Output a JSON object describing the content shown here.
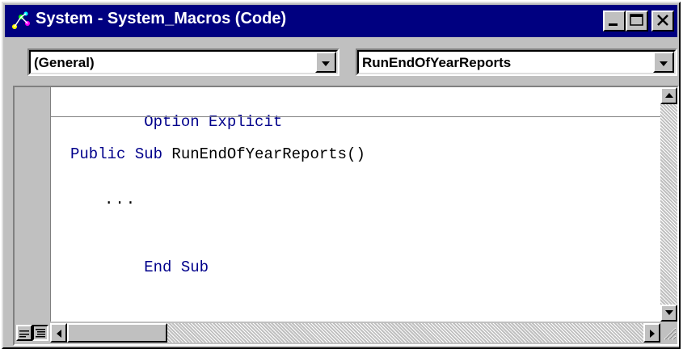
{
  "window": {
    "title": "System - System_Macros (Code)"
  },
  "combos": {
    "object": {
      "value": "(General)"
    },
    "procedure": {
      "value": "RunEndOfYearReports"
    }
  },
  "code": {
    "line1_kw": "Option Explicit",
    "line2_kw": "Public Sub",
    "line2_rest": " RunEndOfYearReports()",
    "line3": "...",
    "line4_kw": "End Sub"
  },
  "colors": {
    "titlebar": "#000080",
    "keyword": "#00008b",
    "face": "#c0c0c0"
  },
  "icons": {
    "app": "vba-project-icon",
    "minimize": "minimize-icon",
    "maximize": "maximize-icon",
    "close": "close-icon"
  }
}
